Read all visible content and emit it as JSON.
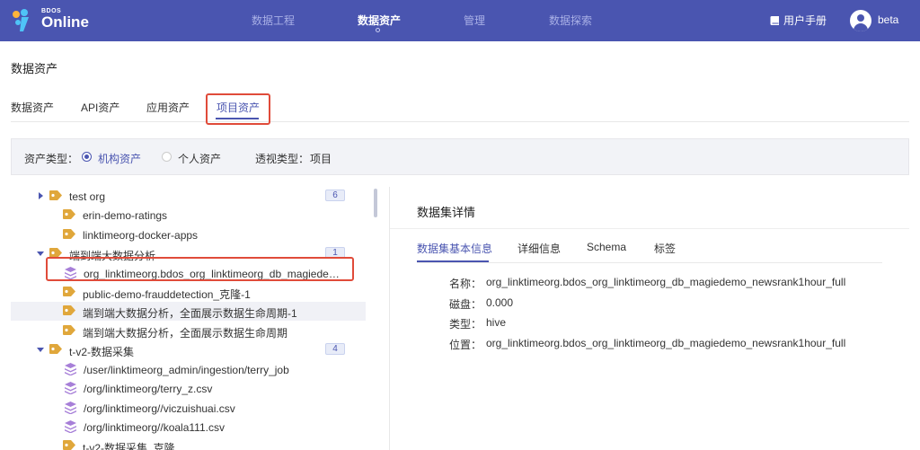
{
  "header": {
    "logo_small": "BDOS",
    "logo_big": "Online",
    "nav": [
      "数据工程",
      "数据资产",
      "管理",
      "数据探索"
    ],
    "active_nav": "数据资产",
    "manual": "用户手册",
    "username": "beta",
    "brand_color": "#4a55b0"
  },
  "page": {
    "title": "数据资产"
  },
  "tabs": [
    "数据资产",
    "API资产",
    "应用资产",
    "项目资产"
  ],
  "active_tab": "项目资产",
  "filter": {
    "asset_type_label": "资产类型：",
    "options": [
      "机构资产",
      "个人资产"
    ],
    "selected": "机构资产",
    "view_type_label": "透视类型：",
    "view_type_value": "项目"
  },
  "tree": [
    {
      "label": "test org",
      "icon": "tag-icon",
      "expand": "collapsed",
      "badge": "6"
    },
    {
      "label": "erin-demo-ratings",
      "icon": "tag-icon"
    },
    {
      "label": "linktimeorg-docker-apps",
      "icon": "tag-icon"
    },
    {
      "label": "端到端大数据分析",
      "icon": "tag-icon",
      "expand": "expanded",
      "badge": "1"
    },
    {
      "label": "org_linktimeorg.bdos_org_linktimeorg_db_magiede…",
      "icon": "layers-icon",
      "selected": true
    },
    {
      "label": "public-demo-frauddetection_克隆-1",
      "icon": "tag-icon"
    },
    {
      "label": "端到端大数据分析，全面展示数据生命周期-1",
      "icon": "tag-icon"
    },
    {
      "label": "端到端大数据分析，全面展示数据生命周期",
      "icon": "tag-icon"
    },
    {
      "label": "t-v2-数据采集",
      "icon": "tag-icon",
      "expand": "expanded",
      "badge": "4"
    },
    {
      "label": "/user/linktimeorg_admin/ingestion/terry_job",
      "icon": "layers-icon"
    },
    {
      "label": "/org/linktimeorg/terry_z.csv",
      "icon": "layers-icon"
    },
    {
      "label": "/org/linktimeorg//viczuishuai.csv",
      "icon": "layers-icon"
    },
    {
      "label": "/org/linktimeorg//koala111.csv",
      "icon": "layers-icon"
    },
    {
      "label": "t-v2-数据采集_克隆",
      "icon": "tag-icon"
    }
  ],
  "detail": {
    "title": "数据集详情",
    "tabs": [
      "数据集基本信息",
      "详细信息",
      "Schema",
      "标签"
    ],
    "active_tab": "数据集基本信息",
    "fields": [
      {
        "key": "名称：",
        "value": "org_linktimeorg.bdos_org_linktimeorg_db_magiedemo_newsrank1hour_full"
      },
      {
        "key": "磁盘：",
        "value": "0.000"
      },
      {
        "key": "类型：",
        "value": "hive"
      },
      {
        "key": "位置：",
        "value": "org_linktimeorg.bdos_org_linktimeorg_db_magiedemo_newsrank1hour_full"
      }
    ]
  }
}
